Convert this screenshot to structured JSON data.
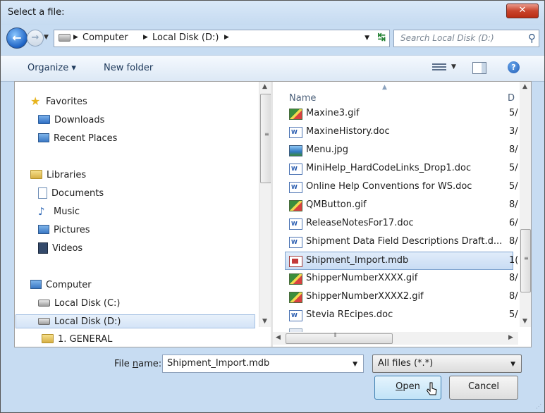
{
  "window": {
    "title": "Select a file:",
    "close_label": "✕"
  },
  "address": {
    "segments": [
      "Computer",
      "Local Disk (D:)"
    ],
    "separator": "▶",
    "search_placeholder": "Search Local Disk (D:)"
  },
  "toolbar": {
    "organize_label": "Organize ▾",
    "new_folder_label": "New folder",
    "help_label": "?"
  },
  "nav": {
    "favorites": {
      "label": "Favorites",
      "items": [
        "Downloads",
        "Recent Places"
      ]
    },
    "libraries": {
      "label": "Libraries",
      "items": [
        "Documents",
        "Music",
        "Pictures",
        "Videos"
      ]
    },
    "computer": {
      "label": "Computer",
      "items": [
        "Local Disk (C:)",
        "Local Disk (D:)",
        "1. GENERAL"
      ]
    },
    "selected_item": "Local Disk (D:)"
  },
  "files": {
    "header_name": "Name",
    "header_date": "D",
    "rows": [
      {
        "name": "Maxine3.gif",
        "type": "gif",
        "date": "5/"
      },
      {
        "name": "MaxineHistory.doc",
        "type": "doc",
        "date": "3/"
      },
      {
        "name": "Menu.jpg",
        "type": "jpg",
        "date": "8/"
      },
      {
        "name": "MiniHelp_HardCodeLinks_Drop1.doc",
        "type": "doc",
        "date": "5/"
      },
      {
        "name": "Online Help Conventions for WS.doc",
        "type": "doc",
        "date": "5/"
      },
      {
        "name": "QMButton.gif",
        "type": "gif",
        "date": "8/"
      },
      {
        "name": "ReleaseNotesFor17.doc",
        "type": "doc",
        "date": "6/"
      },
      {
        "name": "Shipment Data Field Descriptions Draft.d...",
        "type": "doc",
        "date": "8/"
      },
      {
        "name": "Shipment_Import.mdb",
        "type": "mdb",
        "date": "1("
      },
      {
        "name": "ShipperNumberXXXX.gif",
        "type": "gif",
        "date": "8/"
      },
      {
        "name": "ShipperNumberXXXX2.gif",
        "type": "gif",
        "date": "8/"
      },
      {
        "name": "Stevia REcipes.doc",
        "type": "doc",
        "date": "5/"
      }
    ],
    "selected": "Shipment_Import.mdb"
  },
  "footer": {
    "filename_label_pre": "File ",
    "filename_label_u": "n",
    "filename_label_post": "ame:",
    "filename_value": "Shipment_Import.mdb",
    "filetype_value": "All files (*.*)",
    "open_label_u": "O",
    "open_label_post": "pen",
    "cancel_label": "Cancel"
  }
}
